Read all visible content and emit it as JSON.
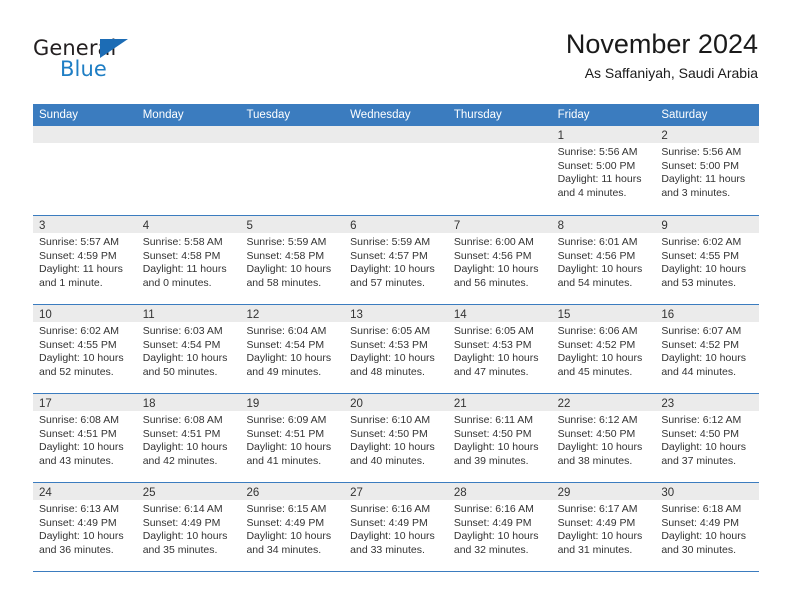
{
  "brand": {
    "name_part1": "General",
    "name_part2": "Blue",
    "accent_color": "#1f7ec4",
    "triangle_color": "#1c6cb5"
  },
  "header": {
    "title": "November 2024",
    "subtitle": "As Saffaniyah, Saudi Arabia"
  },
  "theme": {
    "header_row_bg": "#3b7cbf",
    "daynum_band_bg": "#ebebeb",
    "grid_line": "#3b7cbf",
    "text": "#333333"
  },
  "weekdays": [
    "Sunday",
    "Monday",
    "Tuesday",
    "Wednesday",
    "Thursday",
    "Friday",
    "Saturday"
  ],
  "weeks": [
    [
      {
        "day": "",
        "sunrise": "",
        "sunset": "",
        "daylight1": "",
        "daylight2": "",
        "empty": true
      },
      {
        "day": "",
        "sunrise": "",
        "sunset": "",
        "daylight1": "",
        "daylight2": "",
        "empty": true
      },
      {
        "day": "",
        "sunrise": "",
        "sunset": "",
        "daylight1": "",
        "daylight2": "",
        "empty": true
      },
      {
        "day": "",
        "sunrise": "",
        "sunset": "",
        "daylight1": "",
        "daylight2": "",
        "empty": true
      },
      {
        "day": "",
        "sunrise": "",
        "sunset": "",
        "daylight1": "",
        "daylight2": "",
        "empty": true
      },
      {
        "day": "1",
        "sunrise": "Sunrise: 5:56 AM",
        "sunset": "Sunset: 5:00 PM",
        "daylight1": "Daylight: 11 hours",
        "daylight2": "and 4 minutes."
      },
      {
        "day": "2",
        "sunrise": "Sunrise: 5:56 AM",
        "sunset": "Sunset: 5:00 PM",
        "daylight1": "Daylight: 11 hours",
        "daylight2": "and 3 minutes."
      }
    ],
    [
      {
        "day": "3",
        "sunrise": "Sunrise: 5:57 AM",
        "sunset": "Sunset: 4:59 PM",
        "daylight1": "Daylight: 11 hours",
        "daylight2": "and 1 minute."
      },
      {
        "day": "4",
        "sunrise": "Sunrise: 5:58 AM",
        "sunset": "Sunset: 4:58 PM",
        "daylight1": "Daylight: 11 hours",
        "daylight2": "and 0 minutes."
      },
      {
        "day": "5",
        "sunrise": "Sunrise: 5:59 AM",
        "sunset": "Sunset: 4:58 PM",
        "daylight1": "Daylight: 10 hours",
        "daylight2": "and 58 minutes."
      },
      {
        "day": "6",
        "sunrise": "Sunrise: 5:59 AM",
        "sunset": "Sunset: 4:57 PM",
        "daylight1": "Daylight: 10 hours",
        "daylight2": "and 57 minutes."
      },
      {
        "day": "7",
        "sunrise": "Sunrise: 6:00 AM",
        "sunset": "Sunset: 4:56 PM",
        "daylight1": "Daylight: 10 hours",
        "daylight2": "and 56 minutes."
      },
      {
        "day": "8",
        "sunrise": "Sunrise: 6:01 AM",
        "sunset": "Sunset: 4:56 PM",
        "daylight1": "Daylight: 10 hours",
        "daylight2": "and 54 minutes."
      },
      {
        "day": "9",
        "sunrise": "Sunrise: 6:02 AM",
        "sunset": "Sunset: 4:55 PM",
        "daylight1": "Daylight: 10 hours",
        "daylight2": "and 53 minutes."
      }
    ],
    [
      {
        "day": "10",
        "sunrise": "Sunrise: 6:02 AM",
        "sunset": "Sunset: 4:55 PM",
        "daylight1": "Daylight: 10 hours",
        "daylight2": "and 52 minutes."
      },
      {
        "day": "11",
        "sunrise": "Sunrise: 6:03 AM",
        "sunset": "Sunset: 4:54 PM",
        "daylight1": "Daylight: 10 hours",
        "daylight2": "and 50 minutes."
      },
      {
        "day": "12",
        "sunrise": "Sunrise: 6:04 AM",
        "sunset": "Sunset: 4:54 PM",
        "daylight1": "Daylight: 10 hours",
        "daylight2": "and 49 minutes."
      },
      {
        "day": "13",
        "sunrise": "Sunrise: 6:05 AM",
        "sunset": "Sunset: 4:53 PM",
        "daylight1": "Daylight: 10 hours",
        "daylight2": "and 48 minutes."
      },
      {
        "day": "14",
        "sunrise": "Sunrise: 6:05 AM",
        "sunset": "Sunset: 4:53 PM",
        "daylight1": "Daylight: 10 hours",
        "daylight2": "and 47 minutes."
      },
      {
        "day": "15",
        "sunrise": "Sunrise: 6:06 AM",
        "sunset": "Sunset: 4:52 PM",
        "daylight1": "Daylight: 10 hours",
        "daylight2": "and 45 minutes."
      },
      {
        "day": "16",
        "sunrise": "Sunrise: 6:07 AM",
        "sunset": "Sunset: 4:52 PM",
        "daylight1": "Daylight: 10 hours",
        "daylight2": "and 44 minutes."
      }
    ],
    [
      {
        "day": "17",
        "sunrise": "Sunrise: 6:08 AM",
        "sunset": "Sunset: 4:51 PM",
        "daylight1": "Daylight: 10 hours",
        "daylight2": "and 43 minutes."
      },
      {
        "day": "18",
        "sunrise": "Sunrise: 6:08 AM",
        "sunset": "Sunset: 4:51 PM",
        "daylight1": "Daylight: 10 hours",
        "daylight2": "and 42 minutes."
      },
      {
        "day": "19",
        "sunrise": "Sunrise: 6:09 AM",
        "sunset": "Sunset: 4:51 PM",
        "daylight1": "Daylight: 10 hours",
        "daylight2": "and 41 minutes."
      },
      {
        "day": "20",
        "sunrise": "Sunrise: 6:10 AM",
        "sunset": "Sunset: 4:50 PM",
        "daylight1": "Daylight: 10 hours",
        "daylight2": "and 40 minutes."
      },
      {
        "day": "21",
        "sunrise": "Sunrise: 6:11 AM",
        "sunset": "Sunset: 4:50 PM",
        "daylight1": "Daylight: 10 hours",
        "daylight2": "and 39 minutes."
      },
      {
        "day": "22",
        "sunrise": "Sunrise: 6:12 AM",
        "sunset": "Sunset: 4:50 PM",
        "daylight1": "Daylight: 10 hours",
        "daylight2": "and 38 minutes."
      },
      {
        "day": "23",
        "sunrise": "Sunrise: 6:12 AM",
        "sunset": "Sunset: 4:50 PM",
        "daylight1": "Daylight: 10 hours",
        "daylight2": "and 37 minutes."
      }
    ],
    [
      {
        "day": "24",
        "sunrise": "Sunrise: 6:13 AM",
        "sunset": "Sunset: 4:49 PM",
        "daylight1": "Daylight: 10 hours",
        "daylight2": "and 36 minutes."
      },
      {
        "day": "25",
        "sunrise": "Sunrise: 6:14 AM",
        "sunset": "Sunset: 4:49 PM",
        "daylight1": "Daylight: 10 hours",
        "daylight2": "and 35 minutes."
      },
      {
        "day": "26",
        "sunrise": "Sunrise: 6:15 AM",
        "sunset": "Sunset: 4:49 PM",
        "daylight1": "Daylight: 10 hours",
        "daylight2": "and 34 minutes."
      },
      {
        "day": "27",
        "sunrise": "Sunrise: 6:16 AM",
        "sunset": "Sunset: 4:49 PM",
        "daylight1": "Daylight: 10 hours",
        "daylight2": "and 33 minutes."
      },
      {
        "day": "28",
        "sunrise": "Sunrise: 6:16 AM",
        "sunset": "Sunset: 4:49 PM",
        "daylight1": "Daylight: 10 hours",
        "daylight2": "and 32 minutes."
      },
      {
        "day": "29",
        "sunrise": "Sunrise: 6:17 AM",
        "sunset": "Sunset: 4:49 PM",
        "daylight1": "Daylight: 10 hours",
        "daylight2": "and 31 minutes."
      },
      {
        "day": "30",
        "sunrise": "Sunrise: 6:18 AM",
        "sunset": "Sunset: 4:49 PM",
        "daylight1": "Daylight: 10 hours",
        "daylight2": "and 30 minutes."
      }
    ]
  ]
}
